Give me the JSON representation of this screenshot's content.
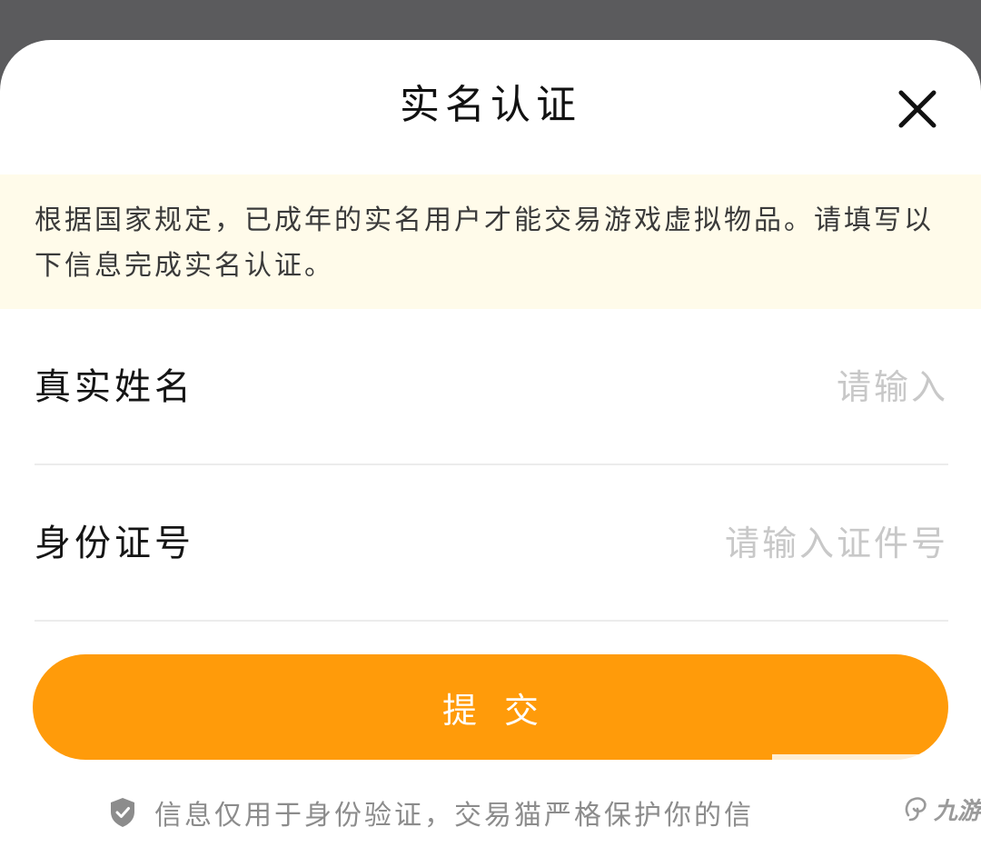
{
  "dialog": {
    "title": "实名认证",
    "close_icon": "close-icon"
  },
  "notice": {
    "text": "根据国家规定，已成年的实名用户才能交易游戏虚拟物品。请填写以下信息完成实名认证。"
  },
  "form": {
    "name": {
      "label": "真实姓名",
      "value": "",
      "placeholder": "请输入"
    },
    "id_number": {
      "label": "身份证号",
      "value": "",
      "placeholder": "请输入证件号"
    }
  },
  "submit": {
    "label": "提交"
  },
  "privacy": {
    "icon": "shield-check-icon",
    "text": "信息仅用于身份验证，交易猫严格保护你的信"
  },
  "watermark": {
    "icon": "jiuyou-logo-icon",
    "text": "九游"
  },
  "colors": {
    "overlay": "#5b5b5d",
    "accent": "#ff9b0a",
    "notice_bg": "#fffbea",
    "placeholder": "#c8c8c8"
  }
}
